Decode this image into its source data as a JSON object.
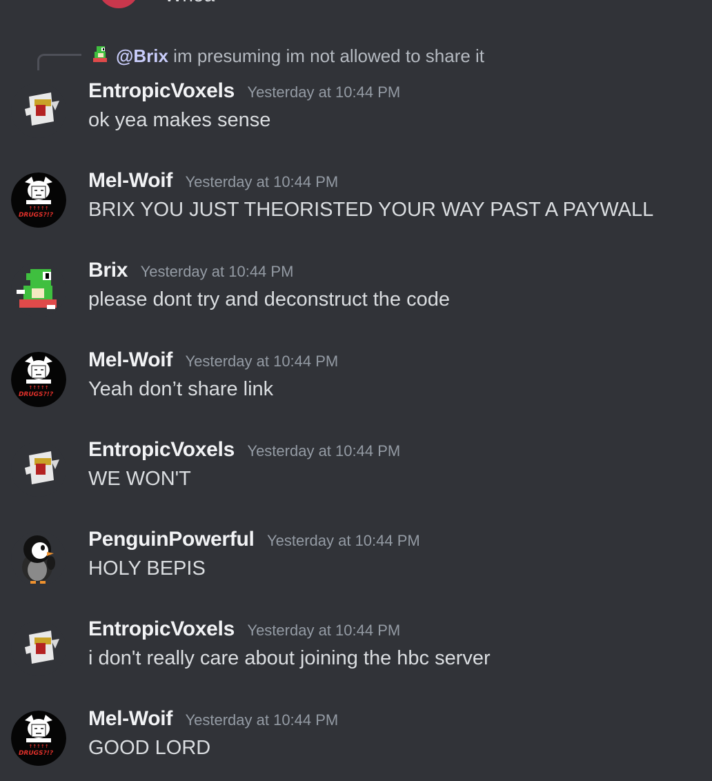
{
  "partial_previous": {
    "text": "Whoa"
  },
  "reply": {
    "mention": "@Brix",
    "text": "im presuming im not allowed to share it"
  },
  "messages": [
    {
      "username": "EntropicVoxels",
      "timestamp": "Yesterday at 10:44 PM",
      "content": "ok yea makes sense",
      "avatar": "entropic-avatar"
    },
    {
      "username": "Mel-Woif",
      "timestamp": "Yesterday at 10:44 PM",
      "content": "BRIX YOU JUST THEORISTED YOUR WAY PAST A PAYWALL",
      "avatar": "mel-avatar"
    },
    {
      "username": "Brix",
      "timestamp": "Yesterday at 10:44 PM",
      "content": "please dont try and deconstruct the code",
      "avatar": "brix-avatar"
    },
    {
      "username": "Mel-Woif",
      "timestamp": "Yesterday at 10:44 PM",
      "content": "Yeah don’t share link",
      "avatar": "mel-avatar"
    },
    {
      "username": "EntropicVoxels",
      "timestamp": "Yesterday at 10:44 PM",
      "content": "WE WON'T",
      "avatar": "entropic-avatar"
    },
    {
      "username": "PenguinPowerful",
      "timestamp": "Yesterday at 10:44 PM",
      "content": "HOLY BEPIS",
      "avatar": "penguin-avatar"
    },
    {
      "username": "EntropicVoxels",
      "timestamp": "Yesterday at 10:44 PM",
      "content": "i don't really care about joining the hbc server",
      "avatar": "entropic-avatar"
    },
    {
      "username": "Mel-Woif",
      "timestamp": "Yesterday at 10:44 PM",
      "content": "GOOD LORD",
      "avatar": "mel-avatar"
    }
  ],
  "avatar_text": {
    "mel": "DRUGS?!?"
  },
  "colors": {
    "background": "#313338",
    "username": "#f2f3f5",
    "timestamp": "#949ba4",
    "mention": "#c9cdfb",
    "text": "#dbdee1"
  }
}
